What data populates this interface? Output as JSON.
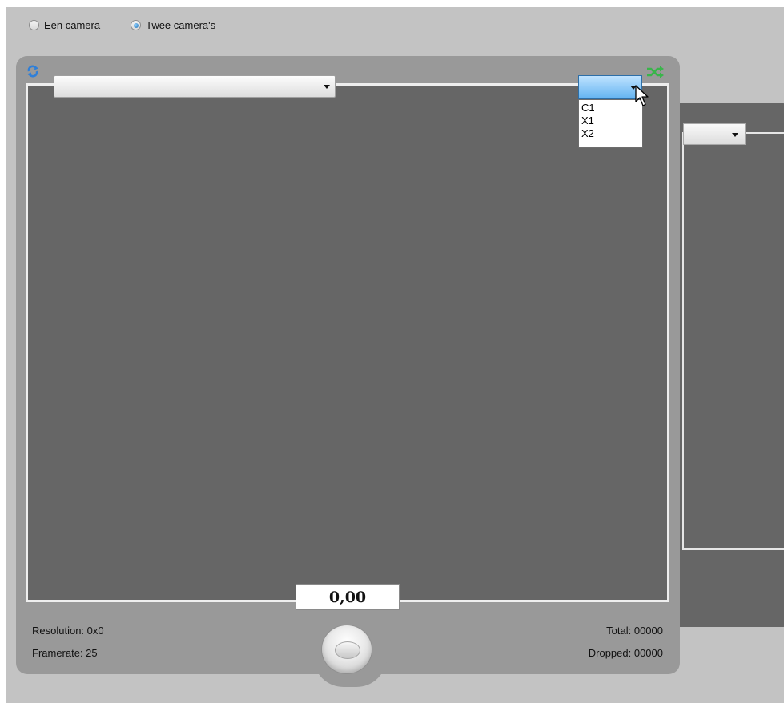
{
  "camera_mode": {
    "options": [
      {
        "label": "Een camera",
        "selected": false
      },
      {
        "label": "Twee camera's",
        "selected": true
      }
    ]
  },
  "main_panel": {
    "camera_select": {
      "value": ""
    },
    "mode_dropdown": {
      "value": "",
      "options": [
        "C1",
        "X1",
        "X2"
      ]
    },
    "timer": "0,00",
    "stats": {
      "resolution": "Resolution: 0x0",
      "framerate": "Framerate: 25",
      "total": "Total: 00000",
      "dropped": "Dropped: 00000"
    }
  },
  "secondary_panel": {
    "camera_select": {
      "value": ""
    }
  },
  "icons": {
    "refresh": "refresh-icon",
    "shuffle": "shuffle-icon",
    "record": "record-button",
    "cursor": "mouse-cursor-icon"
  },
  "colors": {
    "accent": "#64b4f1",
    "panel": "#999999",
    "video": "#666666",
    "shuffle": "#39b54a",
    "refresh": "#2f7fd8"
  }
}
